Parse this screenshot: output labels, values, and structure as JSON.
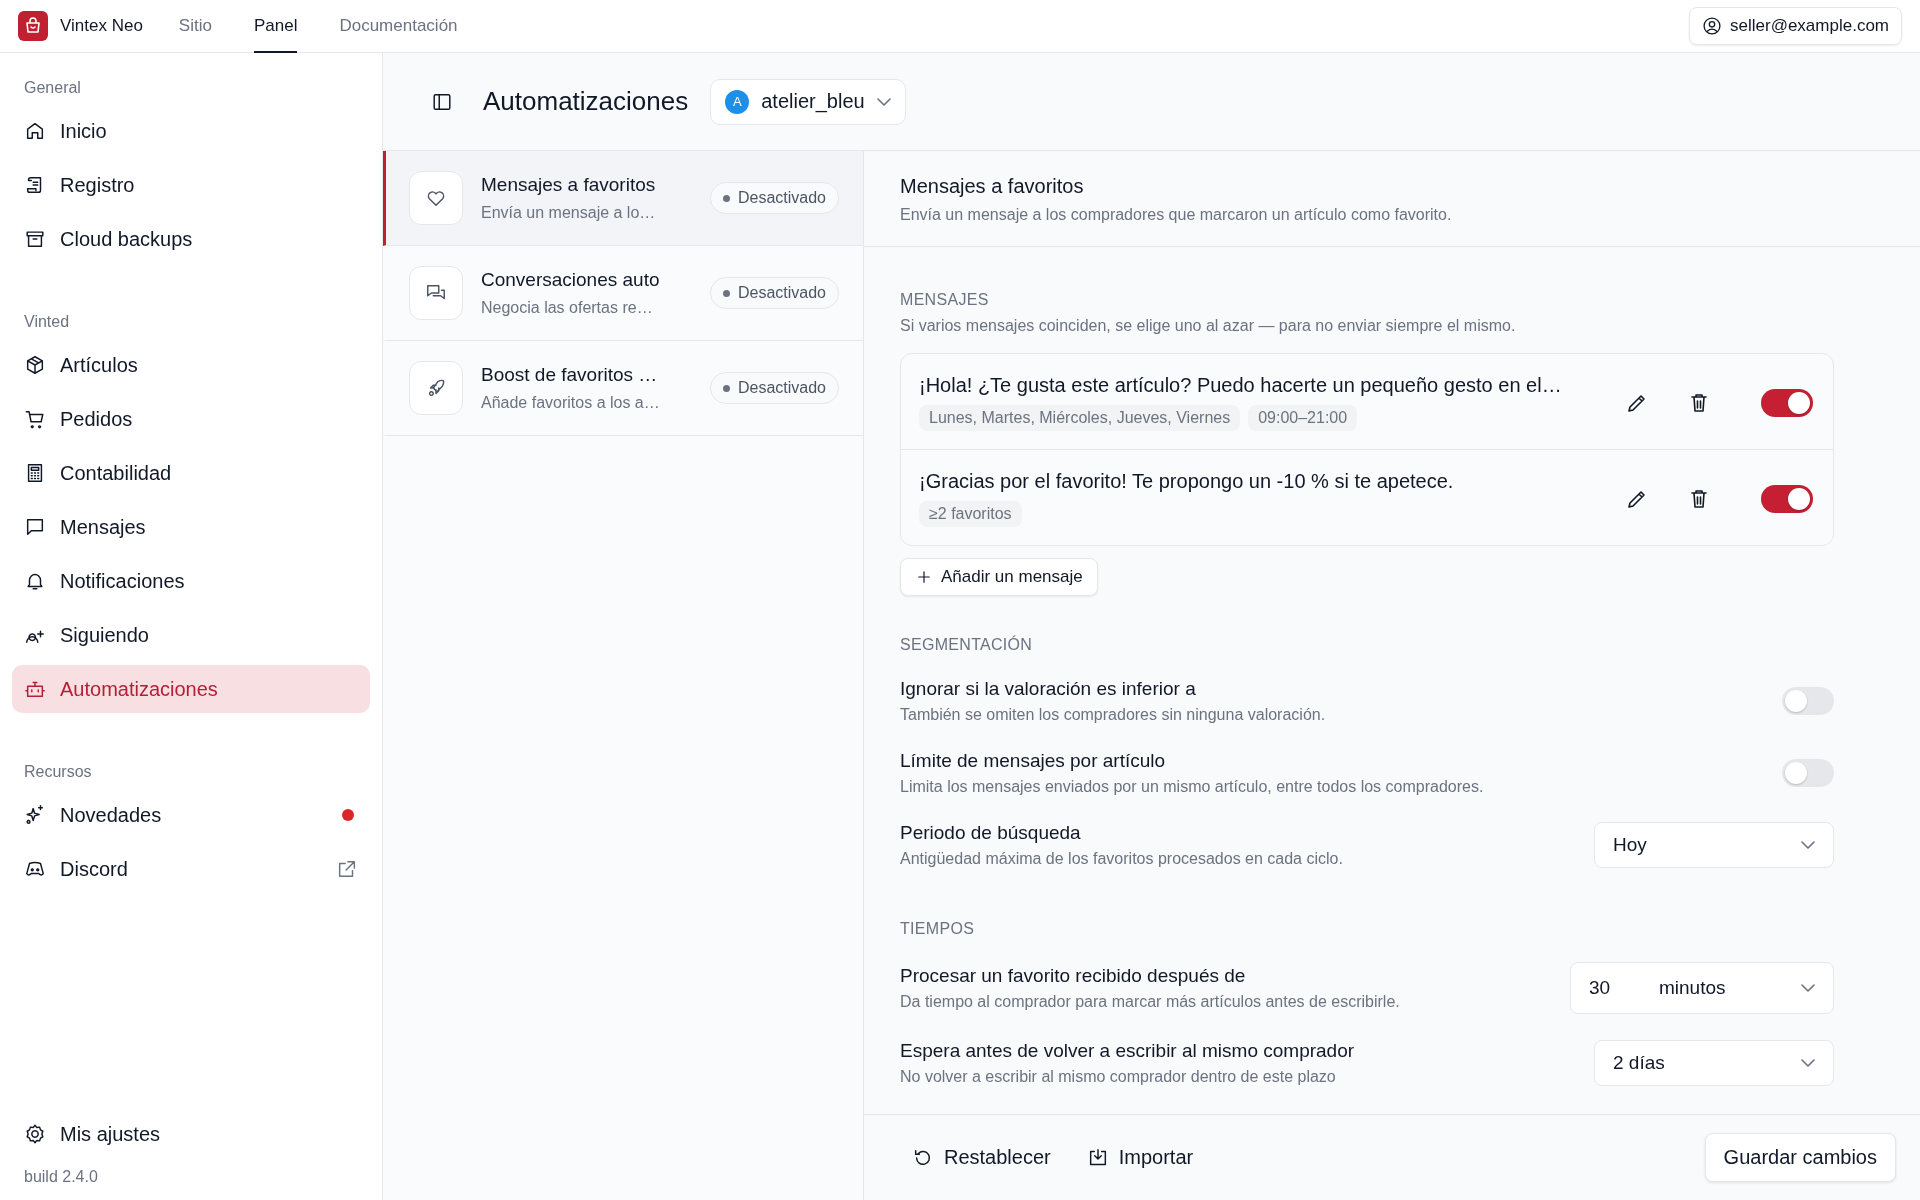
{
  "topbar": {
    "brand": "Vintex Neo",
    "nav": [
      {
        "label": "Sitio",
        "selected": false
      },
      {
        "label": "Panel",
        "selected": true
      },
      {
        "label": "Documentación",
        "selected": false
      }
    ],
    "account": "seller@example.com"
  },
  "sidebar": {
    "sections": [
      {
        "title": "General",
        "items": [
          {
            "label": "Inicio",
            "selected": false,
            "dot": false,
            "external": false
          },
          {
            "label": "Registro",
            "selected": false,
            "dot": false,
            "external": false
          },
          {
            "label": "Cloud backups",
            "selected": false,
            "dot": false,
            "external": false
          }
        ]
      },
      {
        "title": "Vinted",
        "items": [
          {
            "label": "Artículos",
            "selected": false,
            "dot": false,
            "external": false
          },
          {
            "label": "Pedidos",
            "selected": false,
            "dot": false,
            "external": false
          },
          {
            "label": "Contabilidad",
            "selected": false,
            "dot": false,
            "external": false
          },
          {
            "label": "Mensajes",
            "selected": false,
            "dot": false,
            "external": false
          },
          {
            "label": "Notificaciones",
            "selected": false,
            "dot": false,
            "external": false
          },
          {
            "label": "Siguiendo",
            "selected": false,
            "dot": false,
            "external": false
          },
          {
            "label": "Automatizaciones",
            "selected": true,
            "dot": false,
            "external": false
          }
        ]
      },
      {
        "title": "Recursos",
        "items": [
          {
            "label": "Novedades",
            "selected": false,
            "dot": true,
            "external": false
          },
          {
            "label": "Discord",
            "selected": false,
            "dot": false,
            "external": true
          }
        ]
      }
    ],
    "settings": "Mis ajustes",
    "build": "build 2.4.0"
  },
  "header": {
    "title": "Automatizaciones",
    "shop": {
      "avatar": "A",
      "name": "atelier_bleu"
    }
  },
  "automations": [
    {
      "title": "Mensajes a favoritos",
      "description": "Envía un mensaje a lo…",
      "status": "Desactivado",
      "selected": true
    },
    {
      "title": "Conversaciones auto",
      "description": "Negocia las ofertas re…",
      "status": "Desactivado",
      "selected": false
    },
    {
      "title": "Boost de favoritos …",
      "description": "Añade favoritos a los a…",
      "status": "Desactivado",
      "selected": false
    }
  ],
  "detail": {
    "title": "Mensajes a favoritos",
    "description": "Envía un mensaje a los compradores que marcaron un artículo como favorito.",
    "messages": {
      "heading": "MENSAJES",
      "note": "Si varios mensajes coinciden, se elige uno al azar — para no enviar siempre el mismo.",
      "items": [
        {
          "text": "¡Hola! ¿Te gusta este artículo? Puedo hacerte un pequeño gesto en el…",
          "tags": [
            "Lunes, Martes, Miércoles, Jueves, Viernes",
            "09:00–21:00"
          ],
          "enabled": true
        },
        {
          "text": "¡Gracias por el favorito! Te propongo un -10 % si te apetece.",
          "tags": [
            "≥2 favoritos"
          ],
          "enabled": true
        }
      ],
      "add": "Añadir un mensaje"
    },
    "sections": [
      {
        "heading": "SEGMENTACIÓN",
        "rows": [
          {
            "kind": "toggle",
            "label": "Ignorar si la valoración es inferior a",
            "description": "También se omiten los compradores sin ninguna valoración.",
            "on": false
          },
          {
            "kind": "toggle",
            "label": "Límite de mensajes por artículo",
            "description": "Limita los mensajes enviados por un mismo artículo, entre todos los compradores.",
            "on": false
          },
          {
            "kind": "select",
            "label": "Periodo de búsqueda",
            "description": "Antigüedad máxima de los favoritos procesados en cada ciclo.",
            "value": "Hoy"
          }
        ]
      },
      {
        "heading": "TIEMPOS",
        "rows": [
          {
            "kind": "duration",
            "label": "Procesar un favorito recibido después de",
            "description": "Da tiempo al comprador para marcar más artículos antes de escribirle.",
            "value": "30",
            "unit": "minutos"
          },
          {
            "kind": "select",
            "label": "Espera antes de volver a escribir al mismo comprador",
            "description": "No volver a escribir al mismo comprador dentro de este plazo",
            "value": "2 días"
          }
        ]
      }
    ]
  },
  "footer": {
    "reset": "Restablecer",
    "import": "Importar",
    "save": "Guardar cambios"
  }
}
